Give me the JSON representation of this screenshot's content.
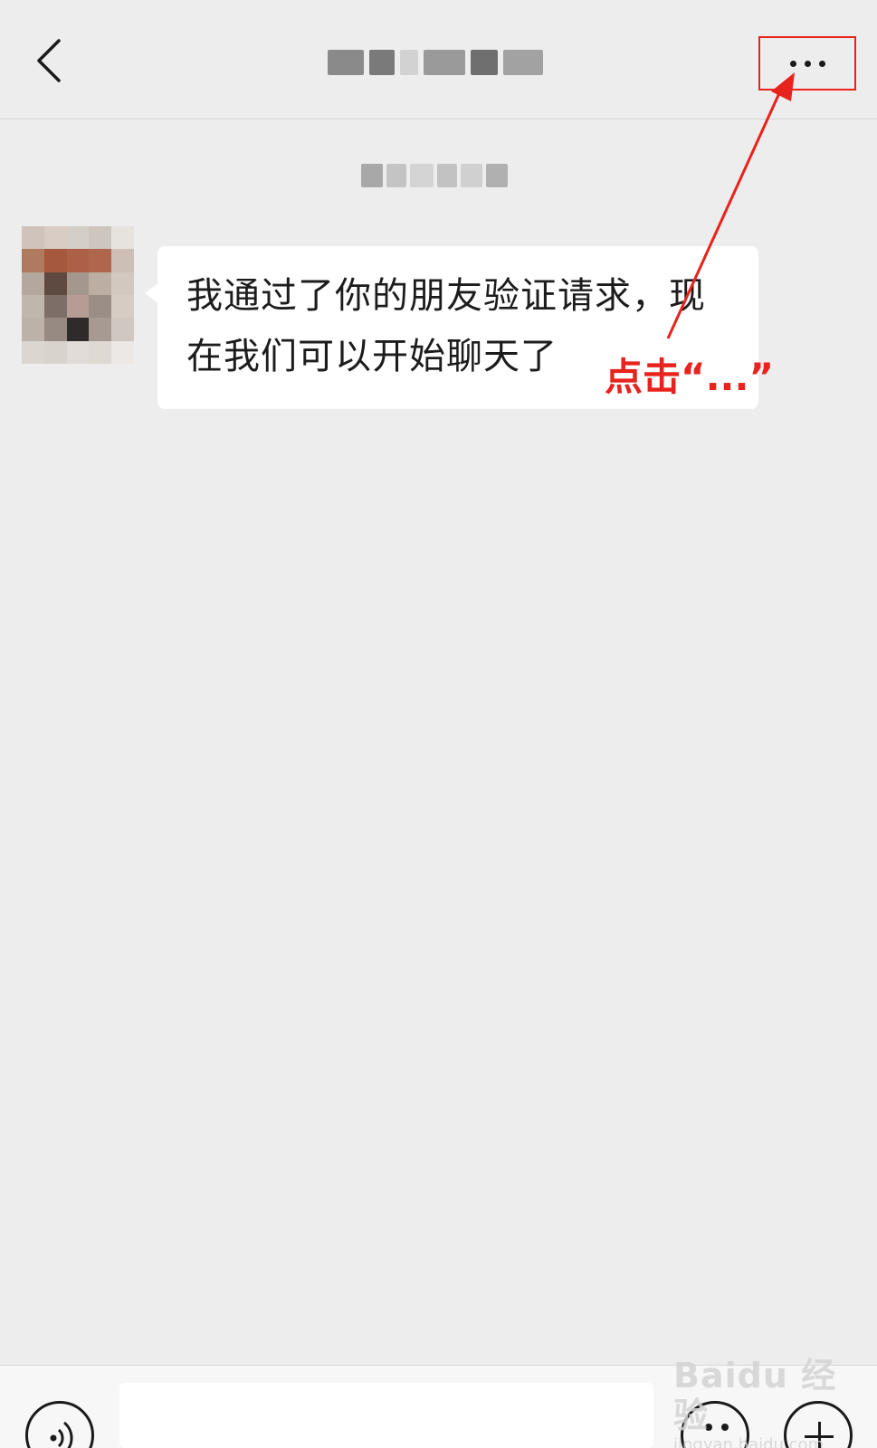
{
  "header": {
    "back_icon": "chevron-left-icon",
    "more_icon": "more-dots-icon"
  },
  "message": {
    "text_line1": "我通过了你的朋友验证请求，现",
    "text_line2": "在我们可以开始聊天了"
  },
  "annotation": {
    "label": "点击“...”",
    "color": "#e8221c"
  },
  "input_bar": {
    "voice_icon": "voice-icon",
    "emoji_icon": "emoji-icon",
    "plus_icon": "plus-icon",
    "input_value": ""
  },
  "watermark": {
    "main": "Baidu 经验",
    "sub": "jingyan.baidu.com"
  },
  "colors": {
    "background": "#ededed",
    "bubble": "#ffffff",
    "annotation": "#e8221c"
  }
}
